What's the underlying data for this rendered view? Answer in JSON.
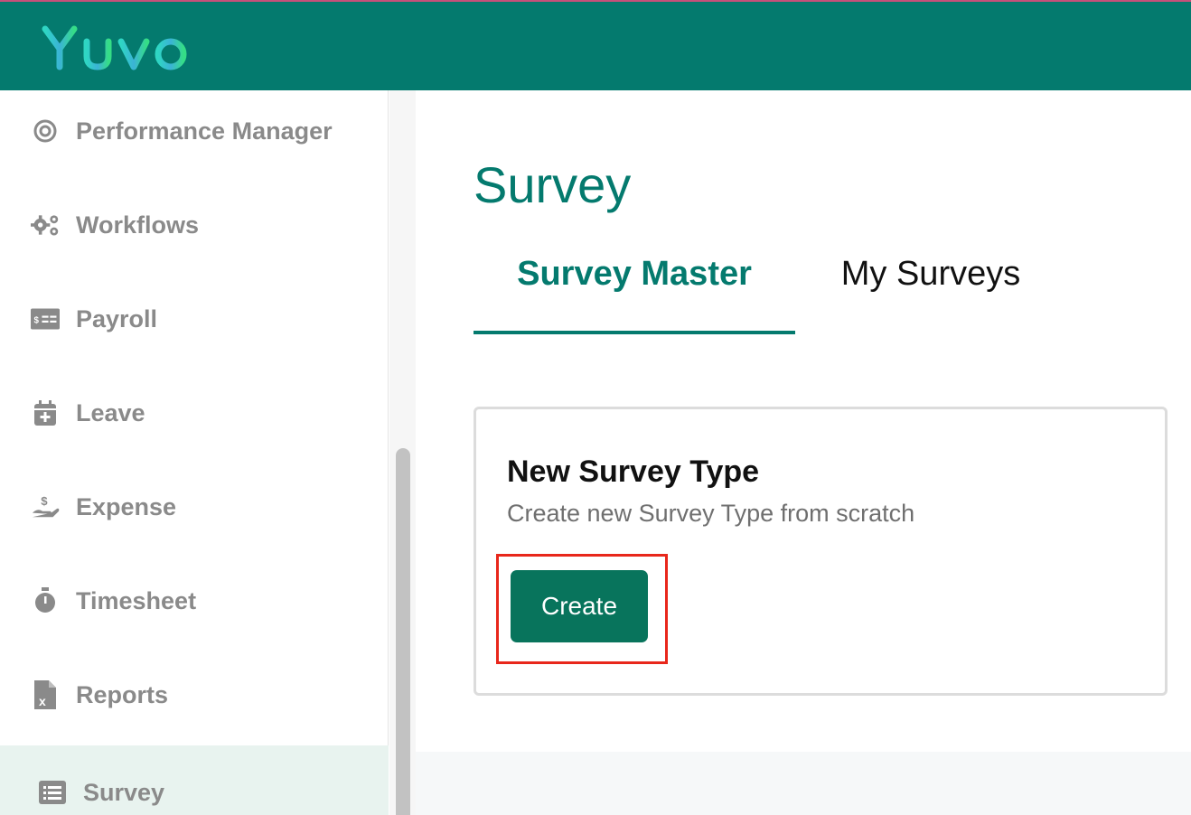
{
  "header": {
    "logo_text": "Yuvo"
  },
  "sidebar": {
    "items": [
      {
        "label": "Performance Manager",
        "icon": "target-icon"
      },
      {
        "label": "Workflows",
        "icon": "gears-icon"
      },
      {
        "label": "Payroll",
        "icon": "money-card-icon"
      },
      {
        "label": "Leave",
        "icon": "calendar-plus-icon"
      },
      {
        "label": "Expense",
        "icon": "hand-dollar-icon"
      },
      {
        "label": "Timesheet",
        "icon": "stopwatch-icon"
      },
      {
        "label": "Reports",
        "icon": "excel-file-icon"
      },
      {
        "label": "Survey",
        "icon": "list-icon",
        "active": true
      }
    ]
  },
  "main": {
    "title": "Survey",
    "tabs": [
      {
        "label": "Survey Master",
        "active": true
      },
      {
        "label": "My Surveys",
        "active": false
      }
    ],
    "card": {
      "title": "New Survey Type",
      "description": "Create new Survey Type from scratch",
      "button_label": "Create"
    }
  },
  "colors": {
    "brand": "#047a6e",
    "button": "#08745c",
    "highlight": "#e8271b",
    "muted_text": "#8a8a8a"
  }
}
